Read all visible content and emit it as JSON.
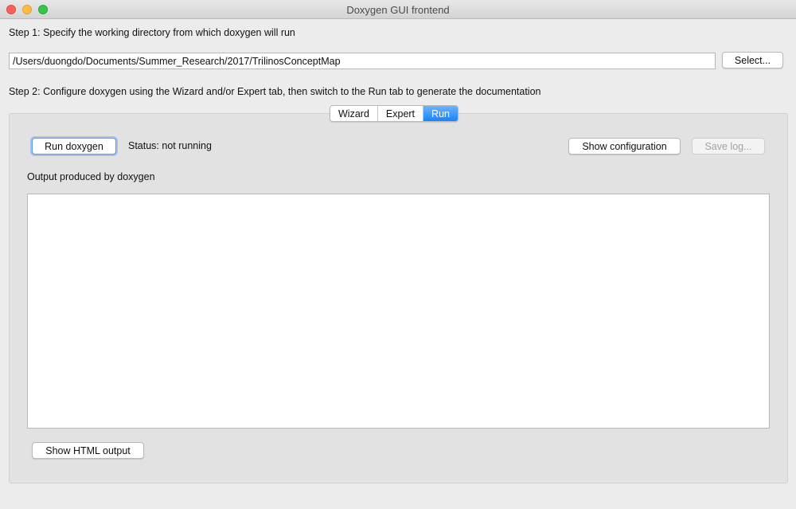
{
  "window": {
    "title": "Doxygen GUI frontend"
  },
  "step1": {
    "label": "Step 1: Specify the working directory from which doxygen will run",
    "directory": "/Users/duongdo/Documents/Summer_Research/2017/TrilinosConceptMap",
    "select_label": "Select..."
  },
  "step2": {
    "label": "Step 2: Configure doxygen using the Wizard and/or Expert tab, then switch to the Run tab to generate the documentation"
  },
  "tabs": [
    {
      "label": "Wizard",
      "active": false
    },
    {
      "label": "Expert",
      "active": false
    },
    {
      "label": "Run",
      "active": true
    }
  ],
  "run": {
    "run_button": "Run doxygen",
    "status": "Status: not running",
    "show_config_button": "Show configuration",
    "save_log_button": "Save log...",
    "output_label": "Output produced by doxygen",
    "output_text": "",
    "show_html_button": "Show HTML output"
  },
  "colors": {
    "accent": "#1a82fb",
    "window_bg": "#ececec",
    "panel_bg": "#e2e2e2"
  }
}
